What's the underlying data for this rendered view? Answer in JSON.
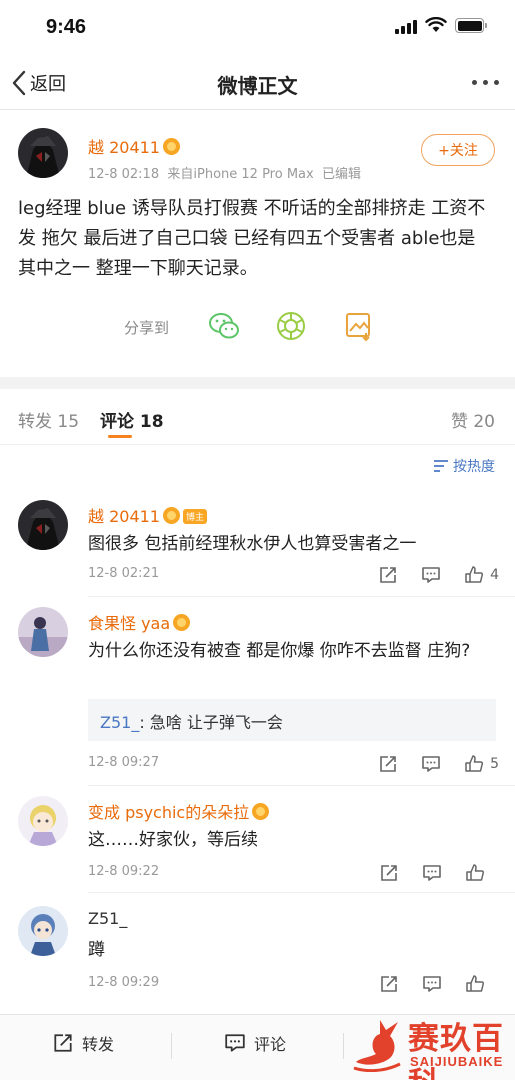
{
  "status_bar": {
    "time": "9:46"
  },
  "nav": {
    "back_label": "返回",
    "title": "微博正文"
  },
  "post": {
    "author": "越 20411",
    "time": "12-8 02:18",
    "source": "来自iPhone 12 Pro Max",
    "edited": "已编辑",
    "follow_label": "+关注",
    "text": "leg经理 blue 诱导队员打假赛 不听话的全部排挤走 工资不发 拖欠 最后进了自己口袋 已经有四五个受害者 able也是其中之一 整理一下聊天记录。",
    "share_label": "分享到"
  },
  "tabs": {
    "repost": "转发 15",
    "comment": "评论 18",
    "like": "赞 20"
  },
  "sort_label": "按热度",
  "comments": [
    {
      "name": "越 20411",
      "host_tag": "博主",
      "text": "图很多 包括前经理秋水伊人也算受害者之一",
      "time": "12-8 02:21",
      "likes": "4"
    },
    {
      "name": "食果怪 yaa",
      "text": "为什么你还没有被查  都是你爆  你咋不去监督 庄狗?",
      "reply_name": "Z51_",
      "reply_text": ": 急啥 让子弹飞一会",
      "time": "12-8 09:27",
      "likes": "5"
    },
    {
      "name": "变成 psychic的朵朵拉",
      "text": "这……好家伙，等后续",
      "time": "12-8 09:22",
      "likes": ""
    },
    {
      "name": "Z51_",
      "text": "蹲",
      "time": "12-8 09:29",
      "likes": ""
    }
  ],
  "bottom_bar": {
    "repost": "转发",
    "comment": "评论"
  },
  "watermark": {
    "main": "赛玖百科",
    "sub": "SAIJIUBAIKE"
  },
  "colors": {
    "accent": "#e86b0c",
    "link": "#4a78c2",
    "tab_underline": "#f58220"
  }
}
